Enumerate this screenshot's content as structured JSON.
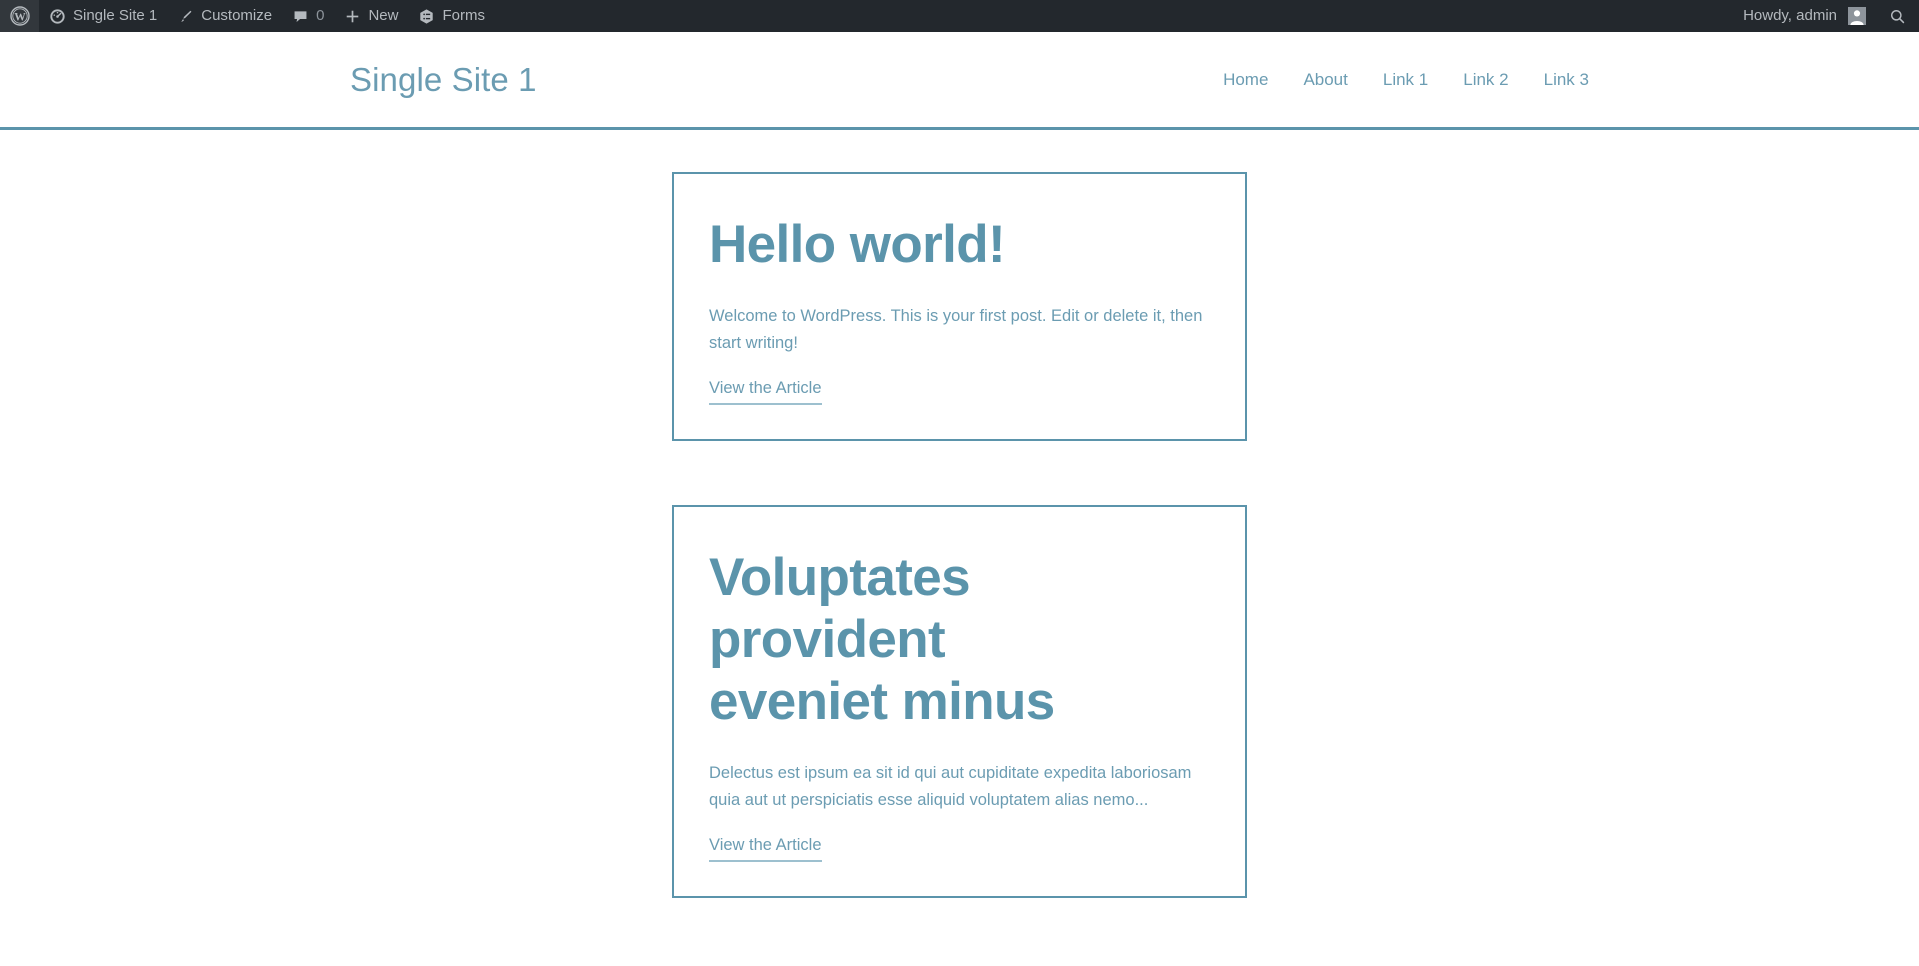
{
  "admin_bar": {
    "left_items": [
      {
        "id": "wp-logo",
        "icon": "wordpress-logo-icon",
        "label": ""
      },
      {
        "id": "site-name",
        "icon": "dashboard-speedometer-icon",
        "label": "Single Site 1"
      },
      {
        "id": "customize",
        "icon": "paintbrush-icon",
        "label": "Customize"
      },
      {
        "id": "comments",
        "icon": "comment-bubble-icon",
        "label": "0"
      },
      {
        "id": "new-content",
        "icon": "plus-icon",
        "label": "New"
      },
      {
        "id": "forms",
        "icon": "forms-hexagon-icon",
        "label": "Forms"
      }
    ],
    "howdy": "Howdy, admin",
    "avatar_icon": "user-avatar-icon",
    "search_icon": "search-icon"
  },
  "site": {
    "title": "Single Site 1",
    "nav": [
      {
        "label": "Home"
      },
      {
        "label": "About"
      },
      {
        "label": "Link 1"
      },
      {
        "label": "Link 2"
      },
      {
        "label": "Link 3"
      }
    ]
  },
  "posts": [
    {
      "title": "Hello world!",
      "excerpt": "Welcome to WordPress. This is your first post. Edit or delete it, then start writing!",
      "link_label": "View the Article"
    },
    {
      "title": "Voluptates provident eveniet minus",
      "excerpt": "Delectus est ipsum ea sit id qui aut cupiditate expedita laboriosam quia aut ut perspiciatis esse aliquid voluptatem alias nemo...",
      "link_label": "View the Article"
    }
  ],
  "colors": {
    "admin_bar_bg": "#23282d",
    "admin_bar_text": "#b4b9be",
    "accent": "#5b94ab",
    "text_blue": "#6b9cb2",
    "page_bg": "#ffffff"
  }
}
